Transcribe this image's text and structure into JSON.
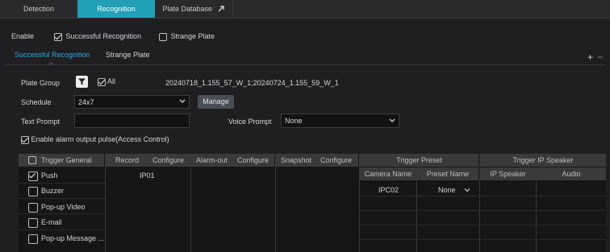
{
  "tabs": {
    "detection": "Detection",
    "recognition": "Recognition",
    "plate_db": "Plate Database",
    "plate_db_icon": "external-link-icon"
  },
  "enable_row": {
    "label": "Enable",
    "successful": "Successful Recognition",
    "strange": "Strange Plate",
    "successful_checked": true,
    "strange_checked": false
  },
  "subtabs": {
    "successful": "Successful Recognition",
    "strange": "Strange Plate",
    "add": "+",
    "remove": "−"
  },
  "form": {
    "plate_group_label": "Plate Group",
    "all_label": "All",
    "plate_groups": "20240718_1.155_57_W_1;20240724_1.155_59_W_1",
    "schedule_label": "Schedule",
    "schedule_value": "24x7",
    "manage": "Manage",
    "text_prompt_label": "Text Prompt",
    "text_prompt_value": "",
    "voice_prompt_label": "Voice Prompt",
    "voice_prompt_value": "None",
    "alarm_pulse": "Enable alarm output pulse(Access Control)"
  },
  "table": {
    "trigger_general": "Trigger General",
    "record": "Record",
    "record_configure": "Configure",
    "alarm_out": "Alarm-out",
    "alarm_configure": "Configure",
    "snapshot": "Snapshot",
    "snapshot_configure": "Configure",
    "trigger_preset": "Trigger Preset",
    "camera_name": "Camera Name",
    "preset_name": "Preset Name",
    "trigger_ip_speaker": "Trigger IP Speaker",
    "ip_speaker": "IP Speaker",
    "audio": "Audio",
    "general_items": [
      {
        "label": "Push",
        "checked": true
      },
      {
        "label": "Buzzer",
        "checked": false
      },
      {
        "label": "Pop-up Video",
        "checked": false
      },
      {
        "label": "E-mail",
        "checked": false
      },
      {
        "label": "Pop-up Message ...",
        "checked": false
      }
    ],
    "record_values": [
      "IP01"
    ],
    "preset_rows": [
      {
        "camera": "IPC02",
        "preset": "None"
      }
    ]
  }
}
